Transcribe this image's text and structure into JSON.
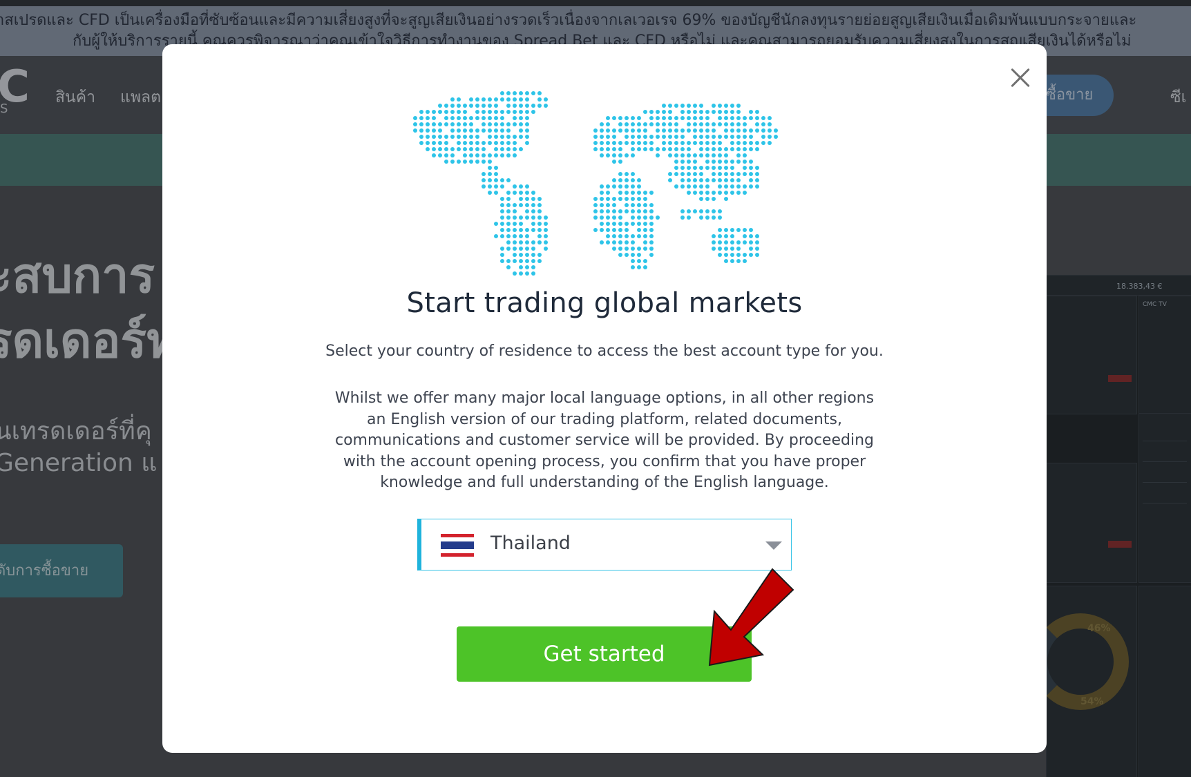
{
  "risk_banner": {
    "line1": "าสเปรดและ CFD เป็นเครื่องมือที่ซับซ้อนและมีความเสี่ยงสูงที่จะสูญเสียเงินอย่างรวดเร็วเนื่องจากเลเวอเรจ 69% ของบัญชีนักลงทุนรายย่อยสูญเสียเงินเมื่อเดิมพันแบบกระจายและ",
    "line2": "กับผู้ให้บริการรายนี้ คุณควรพิจารณาว่าคุณเข้าใจวิธีการทำงานของ Spread Bet และ CFD หรือไม่ และคุณสามารถยอมรับความเสี่ยงสูงในการสูญเสียเงินได้หรือไม่"
  },
  "navbar": {
    "logo": "C",
    "logo_sub": "S",
    "items": [
      "สินค้า",
      "แพลต"
    ],
    "cta_label": "ซื้อขาย",
    "right_item": "ซีเ"
  },
  "hero": {
    "title_line1": "ะสบการ",
    "title_line2": "รดเดอร์ท",
    "sub_line1": "นเทรดเดอร์ที่คุ",
    "sub_line2": " Generation แ",
    "button": "ดับการซื้อขาย"
  },
  "platform_preview": {
    "pct1": "46%",
    "pct2": "54%",
    "value1": "18.383,43 €",
    "tv_label": "CMC TV"
  },
  "modal": {
    "title": "Start trading global markets",
    "subtitle": "Select your country of residence to access the best account type for you.",
    "disclaimer": "Whilst we offer many major local language options, in all other regions an English version of our trading platform, related documents, communications and customer service will be provided. By proceeding with the account opening process, you confirm that you have proper knowledge and full understanding of the English language.",
    "country": {
      "selected": "Thailand",
      "flag": "thailand-flag"
    },
    "cta": "Get started",
    "close_icon": "close-icon"
  },
  "colors": {
    "accent_green": "#4dc328",
    "select_border": "#1fb3dc",
    "map_dots": "#2ec4e8",
    "arrow_red": "#c00000"
  }
}
